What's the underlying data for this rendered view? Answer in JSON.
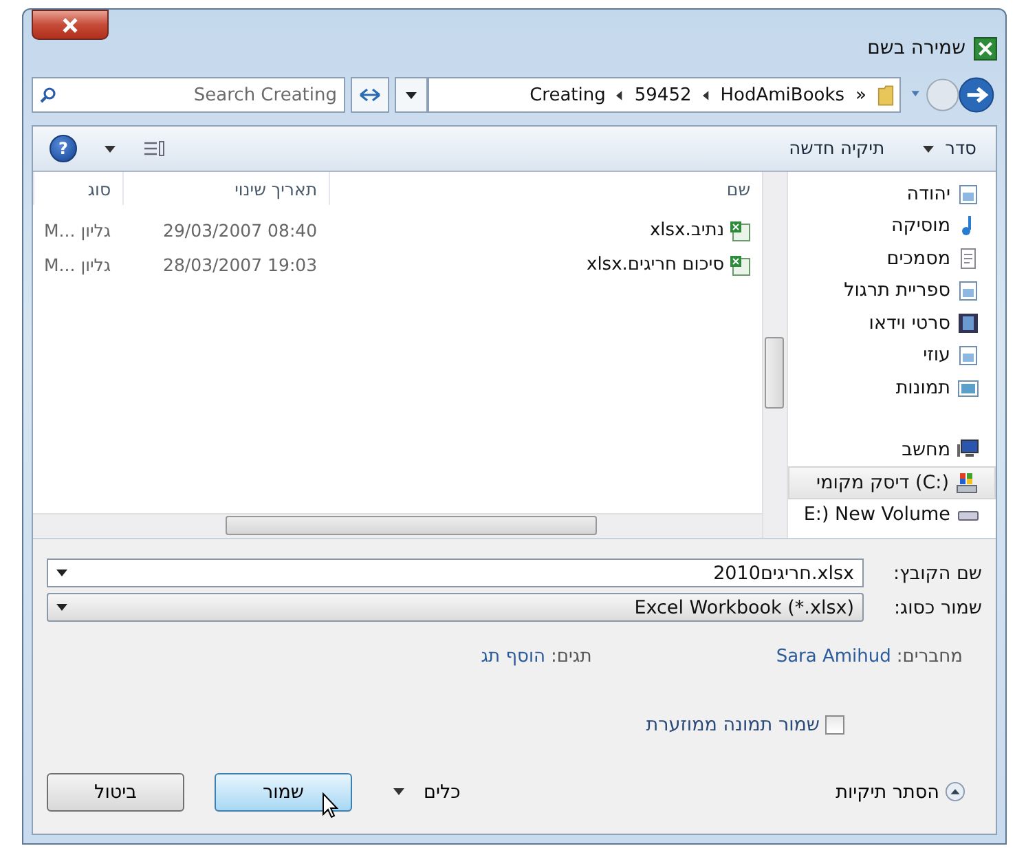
{
  "window": {
    "title": "שמירה בשם"
  },
  "address": {
    "overflow": "»",
    "crumbs": [
      "HodAmiBooks",
      "59452",
      "Creating"
    ]
  },
  "search": {
    "placeholder": "Search Creating"
  },
  "toolbar": {
    "organize": "סדר",
    "new_folder": "תיקיה חדשה",
    "help": "?"
  },
  "nav": {
    "items": [
      {
        "label": "יהודה",
        "kind": "library",
        "selected": false
      },
      {
        "label": "מוסיקה",
        "kind": "music",
        "selected": false
      },
      {
        "label": "מסמכים",
        "kind": "document",
        "selected": false
      },
      {
        "label": "ספריית תרגול",
        "kind": "library",
        "selected": false
      },
      {
        "label": "סרטי וידאו",
        "kind": "video",
        "selected": false
      },
      {
        "label": "עוזי",
        "kind": "library",
        "selected": false
      },
      {
        "label": "תמונות",
        "kind": "picture",
        "selected": false
      },
      {
        "label": "מחשב",
        "kind": "computer",
        "selected": false
      },
      {
        "label": "דיסק מקומי (C:)",
        "kind": "system-drive",
        "selected": true
      },
      {
        "label": "E:) New Volume",
        "kind": "drive",
        "selected": false
      }
    ]
  },
  "files": {
    "columns": [
      "שם",
      "תאריך שינוי",
      "סוג"
    ],
    "rows": [
      {
        "name": "נתיב.xlsx",
        "date": "29/03/2007 08:40",
        "type": "M... גליון"
      },
      {
        "name": "סיכום חריגים.xlsx",
        "date": "28/03/2007 19:03",
        "type": "M... גליון"
      }
    ]
  },
  "form": {
    "file_name_label": "שם הקובץ:",
    "file_name": "2010חריגים.xlsx",
    "type_label": "שמור כסוג:",
    "type": "Excel Workbook (*.xlsx)",
    "authors_label": "מחברים:",
    "authors": "Sara Amihud",
    "tags_label": "תגים:",
    "tags": "הוסף תג",
    "thumbnail": {
      "label": "שמור תמונה ממוזערת",
      "checked": false
    }
  },
  "footer": {
    "hide_folders": "הסתר תיקיות",
    "tools": "כלים",
    "save": "שמור",
    "cancel": "ביטול"
  }
}
